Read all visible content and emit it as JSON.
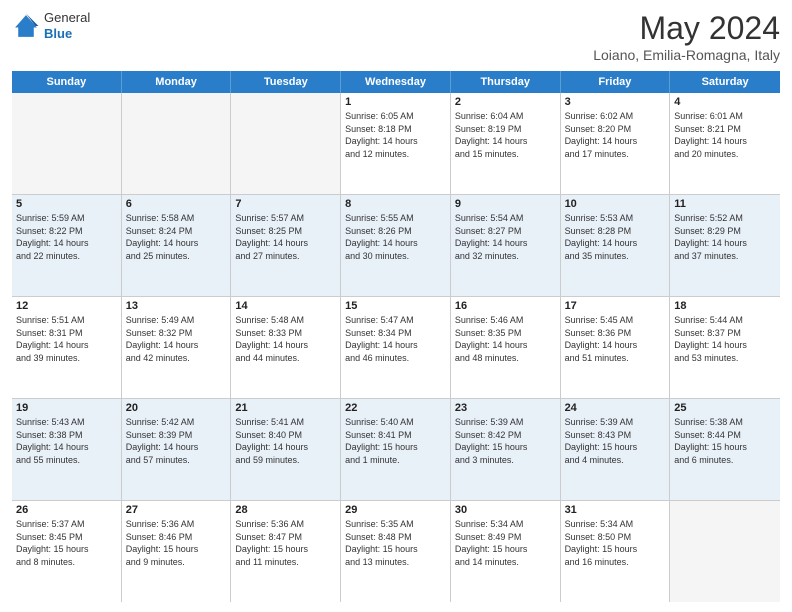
{
  "header": {
    "logo": {
      "general": "General",
      "blue": "Blue"
    },
    "title": "May 2024",
    "subtitle": "Loiano, Emilia-Romagna, Italy"
  },
  "calendar": {
    "days_of_week": [
      "Sunday",
      "Monday",
      "Tuesday",
      "Wednesday",
      "Thursday",
      "Friday",
      "Saturday"
    ],
    "rows": [
      {
        "alt": false,
        "cells": [
          {
            "day": "",
            "empty": true,
            "details": []
          },
          {
            "day": "",
            "empty": true,
            "details": []
          },
          {
            "day": "",
            "empty": true,
            "details": []
          },
          {
            "day": "1",
            "empty": false,
            "details": [
              "Sunrise: 6:05 AM",
              "Sunset: 8:18 PM",
              "Daylight: 14 hours",
              "and 12 minutes."
            ]
          },
          {
            "day": "2",
            "empty": false,
            "details": [
              "Sunrise: 6:04 AM",
              "Sunset: 8:19 PM",
              "Daylight: 14 hours",
              "and 15 minutes."
            ]
          },
          {
            "day": "3",
            "empty": false,
            "details": [
              "Sunrise: 6:02 AM",
              "Sunset: 8:20 PM",
              "Daylight: 14 hours",
              "and 17 minutes."
            ]
          },
          {
            "day": "4",
            "empty": false,
            "details": [
              "Sunrise: 6:01 AM",
              "Sunset: 8:21 PM",
              "Daylight: 14 hours",
              "and 20 minutes."
            ]
          }
        ]
      },
      {
        "alt": true,
        "cells": [
          {
            "day": "5",
            "empty": false,
            "details": [
              "Sunrise: 5:59 AM",
              "Sunset: 8:22 PM",
              "Daylight: 14 hours",
              "and 22 minutes."
            ]
          },
          {
            "day": "6",
            "empty": false,
            "details": [
              "Sunrise: 5:58 AM",
              "Sunset: 8:24 PM",
              "Daylight: 14 hours",
              "and 25 minutes."
            ]
          },
          {
            "day": "7",
            "empty": false,
            "details": [
              "Sunrise: 5:57 AM",
              "Sunset: 8:25 PM",
              "Daylight: 14 hours",
              "and 27 minutes."
            ]
          },
          {
            "day": "8",
            "empty": false,
            "details": [
              "Sunrise: 5:55 AM",
              "Sunset: 8:26 PM",
              "Daylight: 14 hours",
              "and 30 minutes."
            ]
          },
          {
            "day": "9",
            "empty": false,
            "details": [
              "Sunrise: 5:54 AM",
              "Sunset: 8:27 PM",
              "Daylight: 14 hours",
              "and 32 minutes."
            ]
          },
          {
            "day": "10",
            "empty": false,
            "details": [
              "Sunrise: 5:53 AM",
              "Sunset: 8:28 PM",
              "Daylight: 14 hours",
              "and 35 minutes."
            ]
          },
          {
            "day": "11",
            "empty": false,
            "details": [
              "Sunrise: 5:52 AM",
              "Sunset: 8:29 PM",
              "Daylight: 14 hours",
              "and 37 minutes."
            ]
          }
        ]
      },
      {
        "alt": false,
        "cells": [
          {
            "day": "12",
            "empty": false,
            "details": [
              "Sunrise: 5:51 AM",
              "Sunset: 8:31 PM",
              "Daylight: 14 hours",
              "and 39 minutes."
            ]
          },
          {
            "day": "13",
            "empty": false,
            "details": [
              "Sunrise: 5:49 AM",
              "Sunset: 8:32 PM",
              "Daylight: 14 hours",
              "and 42 minutes."
            ]
          },
          {
            "day": "14",
            "empty": false,
            "details": [
              "Sunrise: 5:48 AM",
              "Sunset: 8:33 PM",
              "Daylight: 14 hours",
              "and 44 minutes."
            ]
          },
          {
            "day": "15",
            "empty": false,
            "details": [
              "Sunrise: 5:47 AM",
              "Sunset: 8:34 PM",
              "Daylight: 14 hours",
              "and 46 minutes."
            ]
          },
          {
            "day": "16",
            "empty": false,
            "details": [
              "Sunrise: 5:46 AM",
              "Sunset: 8:35 PM",
              "Daylight: 14 hours",
              "and 48 minutes."
            ]
          },
          {
            "day": "17",
            "empty": false,
            "details": [
              "Sunrise: 5:45 AM",
              "Sunset: 8:36 PM",
              "Daylight: 14 hours",
              "and 51 minutes."
            ]
          },
          {
            "day": "18",
            "empty": false,
            "details": [
              "Sunrise: 5:44 AM",
              "Sunset: 8:37 PM",
              "Daylight: 14 hours",
              "and 53 minutes."
            ]
          }
        ]
      },
      {
        "alt": true,
        "cells": [
          {
            "day": "19",
            "empty": false,
            "details": [
              "Sunrise: 5:43 AM",
              "Sunset: 8:38 PM",
              "Daylight: 14 hours",
              "and 55 minutes."
            ]
          },
          {
            "day": "20",
            "empty": false,
            "details": [
              "Sunrise: 5:42 AM",
              "Sunset: 8:39 PM",
              "Daylight: 14 hours",
              "and 57 minutes."
            ]
          },
          {
            "day": "21",
            "empty": false,
            "details": [
              "Sunrise: 5:41 AM",
              "Sunset: 8:40 PM",
              "Daylight: 14 hours",
              "and 59 minutes."
            ]
          },
          {
            "day": "22",
            "empty": false,
            "details": [
              "Sunrise: 5:40 AM",
              "Sunset: 8:41 PM",
              "Daylight: 15 hours",
              "and 1 minute."
            ]
          },
          {
            "day": "23",
            "empty": false,
            "details": [
              "Sunrise: 5:39 AM",
              "Sunset: 8:42 PM",
              "Daylight: 15 hours",
              "and 3 minutes."
            ]
          },
          {
            "day": "24",
            "empty": false,
            "details": [
              "Sunrise: 5:39 AM",
              "Sunset: 8:43 PM",
              "Daylight: 15 hours",
              "and 4 minutes."
            ]
          },
          {
            "day": "25",
            "empty": false,
            "details": [
              "Sunrise: 5:38 AM",
              "Sunset: 8:44 PM",
              "Daylight: 15 hours",
              "and 6 minutes."
            ]
          }
        ]
      },
      {
        "alt": false,
        "cells": [
          {
            "day": "26",
            "empty": false,
            "details": [
              "Sunrise: 5:37 AM",
              "Sunset: 8:45 PM",
              "Daylight: 15 hours",
              "and 8 minutes."
            ]
          },
          {
            "day": "27",
            "empty": false,
            "details": [
              "Sunrise: 5:36 AM",
              "Sunset: 8:46 PM",
              "Daylight: 15 hours",
              "and 9 minutes."
            ]
          },
          {
            "day": "28",
            "empty": false,
            "details": [
              "Sunrise: 5:36 AM",
              "Sunset: 8:47 PM",
              "Daylight: 15 hours",
              "and 11 minutes."
            ]
          },
          {
            "day": "29",
            "empty": false,
            "details": [
              "Sunrise: 5:35 AM",
              "Sunset: 8:48 PM",
              "Daylight: 15 hours",
              "and 13 minutes."
            ]
          },
          {
            "day": "30",
            "empty": false,
            "details": [
              "Sunrise: 5:34 AM",
              "Sunset: 8:49 PM",
              "Daylight: 15 hours",
              "and 14 minutes."
            ]
          },
          {
            "day": "31",
            "empty": false,
            "details": [
              "Sunrise: 5:34 AM",
              "Sunset: 8:50 PM",
              "Daylight: 15 hours",
              "and 16 minutes."
            ]
          },
          {
            "day": "",
            "empty": true,
            "details": []
          }
        ]
      }
    ]
  }
}
